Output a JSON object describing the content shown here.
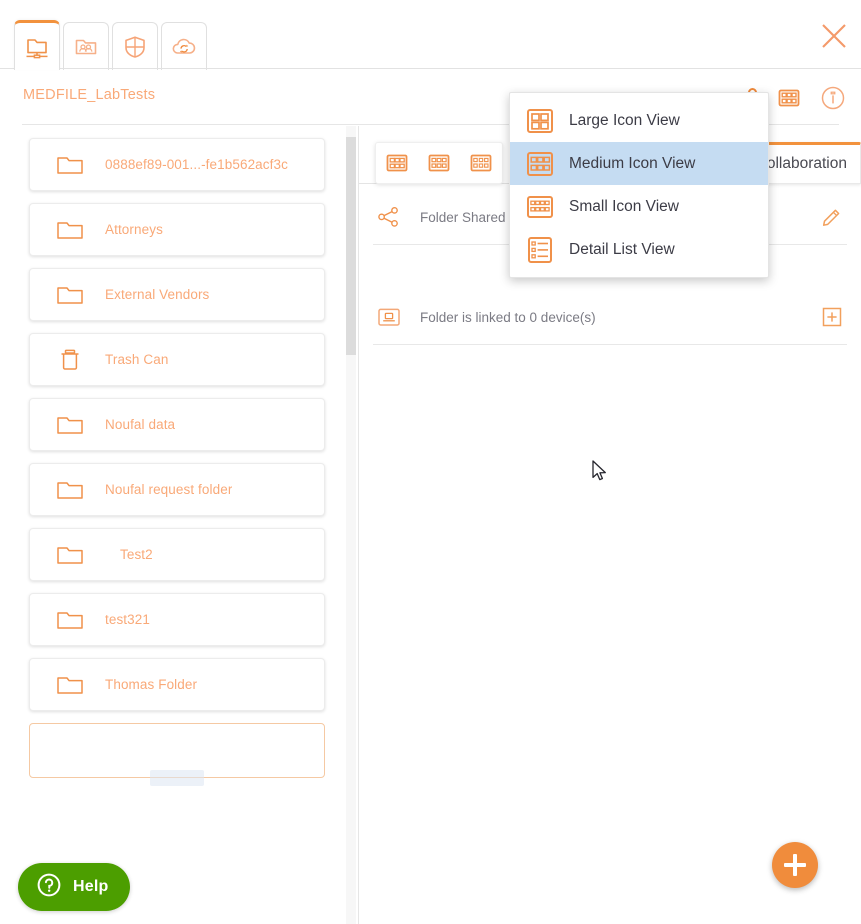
{
  "window": {
    "close_label": "×",
    "accent_color": "#f08c3c",
    "folder_text_color": "#f9a978",
    "selected_menu_bg": "#c5dcf2"
  },
  "tabs": [
    {
      "name": "network-folder-tab",
      "icon": "network-folder-icon",
      "active": true
    },
    {
      "name": "shared-folder-tab",
      "icon": "shared-folder-people-icon",
      "active": false
    },
    {
      "name": "security-tab",
      "icon": "shield-icon",
      "active": false
    },
    {
      "name": "cloud-sync-tab",
      "icon": "cloud-sync-icon",
      "active": false
    }
  ],
  "header": {
    "title": "MEDFILE_LabTests",
    "icons": [
      {
        "name": "grid-view-icon",
        "label": "grid-view-icon"
      },
      {
        "name": "info-icon",
        "label": "info-icon"
      }
    ]
  },
  "sidebar": {
    "folders": [
      {
        "label": "0888ef89-001...-fe1b562acf3c",
        "icon": "folder-icon",
        "indent": false
      },
      {
        "label": "Attorneys",
        "icon": "folder-icon",
        "indent": false
      },
      {
        "label": "External Vendors",
        "icon": "folder-icon",
        "indent": false
      },
      {
        "label": "Trash Can",
        "icon": "trash-icon",
        "indent": false
      },
      {
        "label": "Noufal data",
        "icon": "folder-icon",
        "indent": false
      },
      {
        "label": "Noufal request folder",
        "icon": "folder-icon",
        "indent": false
      },
      {
        "label": "Test2",
        "icon": "folder-icon",
        "indent": true
      },
      {
        "label": "test321",
        "icon": "folder-icon",
        "indent": false
      },
      {
        "label": "Thomas Folder",
        "icon": "folder-icon",
        "indent": false
      }
    ]
  },
  "main": {
    "view_toolbar": [
      {
        "name": "large-icon-view-button",
        "icon": "large-icon-grid-icon"
      },
      {
        "name": "medium-icon-view-button",
        "icon": "medium-icon-grid-icon"
      },
      {
        "name": "small-icon-view-button",
        "icon": "small-icon-grid-icon"
      }
    ],
    "collaboration_tab": "Collaboration",
    "rows": [
      {
        "name": "folder-shared-row",
        "icon": "share-icon",
        "text": "Folder Shared with",
        "action": "edit-pencil-icon"
      },
      {
        "name": "folder-linked-row",
        "icon": "device-folder-icon",
        "text": "Folder is linked to 0 device(s)",
        "action": "add-plus-icon"
      }
    ]
  },
  "dropdown": {
    "items": [
      {
        "label": "Large Icon View",
        "icon": "large-icon-view-icon",
        "selected": false
      },
      {
        "label": "Medium Icon View",
        "icon": "medium-icon-view-icon",
        "selected": true
      },
      {
        "label": "Small Icon View",
        "icon": "small-icon-view-icon",
        "selected": false
      },
      {
        "label": "Detail List View",
        "icon": "detail-list-view-icon",
        "selected": false
      }
    ]
  },
  "fab": {
    "label": "+",
    "name": "add-button"
  },
  "help": {
    "label": "Help",
    "icon": "question-mark-icon"
  }
}
